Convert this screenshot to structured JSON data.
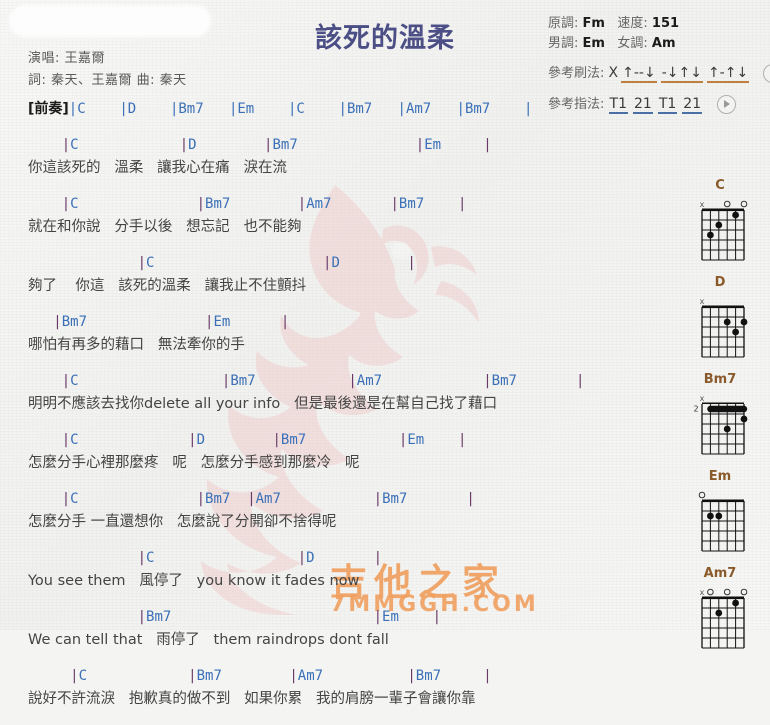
{
  "title": "該死的溫柔",
  "credits": {
    "singer": "演唱: 王嘉爾",
    "writer": "詞: 秦天、王嘉爾  曲: 秦天"
  },
  "meta": {
    "original_key_label": "原調:",
    "original_key": "Fm",
    "tempo_label": "速度:",
    "tempo": "151",
    "male_key_label": "男調:",
    "male_key": "Em",
    "female_key_label": "女調:",
    "female_key": "Am",
    "strum_label": "參考刷法:",
    "strum_x": "X",
    "strum_groups": [
      "↑--↓",
      "-↓↑↓",
      "↑-↑↓"
    ],
    "finger_label": "參考指法:",
    "finger_groups": [
      "T1",
      "21",
      "T1",
      "21"
    ]
  },
  "intro": {
    "label": "[前奏]",
    "chords": "|C    |D    |Bm7   |Em    |C    |Bm7   |Am7   |Bm7    |"
  },
  "stanzas": [
    {
      "chords": "    |C            |D        |Bm7              |Em     |",
      "lyrics": "你這該死的   溫柔   讓我心在痛   淚在流"
    },
    {
      "chords": "    |C              |Bm7        |Am7       |Bm7    |",
      "lyrics": "就在和你說   分手以後   想忘記   也不能夠"
    },
    {
      "chords": "             |C                    |D        |",
      "lyrics": "夠了    你這   該死的溫柔   讓我止不住顫抖"
    },
    {
      "chords": "   |Bm7              |Em      |",
      "lyrics": "哪怕有再多的藉口   無法牽你的手"
    },
    {
      "chords": "    |C                 |Bm7           |Am7            |Bm7       |",
      "lyrics": "明明不應該去找你delete all your info   但是最後還是在幫自己找了藉口"
    },
    {
      "chords": "    |C             |D        |Bm7           |Em    |",
      "lyrics": "怎麼分手心裡那麼疼   呢   怎麼分手感到那麼冷   呢"
    },
    {
      "chords": "    |C              |Bm7  |Am7           |Bm7       |",
      "lyrics": "怎麼分手 一直還想你   怎麼說了分開卻不捨得呢"
    },
    {
      "chords": "             |C                 |D       |",
      "lyrics": "You see them   風停了   you know it fades now"
    },
    {
      "chords": "             |Bm7                        |Em    |",
      "lyrics": "We can tell that   雨停了   them raindrops dont fall"
    },
    {
      "chords": "     |C            |Bm7        |Am7          |Bm7     |",
      "lyrics": "說好不許流淚   抱歉真的做不到   如果你累   我的肩膀一輩子會讓你靠"
    }
  ],
  "chord_diagrams": [
    {
      "name": "C",
      "base_fret": "",
      "markers": [
        "x",
        "",
        "",
        "o",
        "",
        "o"
      ],
      "dots": [
        {
          "string": 5,
          "fret": 3
        },
        {
          "string": 4,
          "fret": 2
        },
        {
          "string": 2,
          "fret": 1
        }
      ],
      "barre": null
    },
    {
      "name": "D",
      "base_fret": "",
      "markers": [
        "x",
        "",
        "",
        "",
        "",
        ""
      ],
      "dots": [
        {
          "string": 3,
          "fret": 2
        },
        {
          "string": 1,
          "fret": 2
        },
        {
          "string": 2,
          "fret": 3
        }
      ],
      "barre": null
    },
    {
      "name": "Bm7",
      "base_fret": "2",
      "markers": [
        "x",
        "",
        "",
        "",
        "",
        ""
      ],
      "dots": [
        {
          "string": 1,
          "fret": 2
        },
        {
          "string": 3,
          "fret": 3
        }
      ],
      "barre": {
        "fret": 1,
        "from_string": 5,
        "to_string": 1
      }
    },
    {
      "name": "Em",
      "base_fret": "",
      "markers": [
        "o",
        "",
        "",
        "",
        "",
        ""
      ],
      "dots": [
        {
          "string": 5,
          "fret": 2
        },
        {
          "string": 4,
          "fret": 2
        }
      ],
      "barre": null
    },
    {
      "name": "Am7",
      "base_fret": "",
      "markers": [
        "x",
        "o",
        "",
        "o",
        "",
        "o"
      ],
      "dots": [
        {
          "string": 4,
          "fret": 2
        },
        {
          "string": 2,
          "fret": 1
        }
      ],
      "barre": null
    }
  ],
  "watermark": {
    "brand": "吉他之家",
    "url": "7MMGGH.COM"
  },
  "colors": {
    "title": "#4c4f86",
    "chord": "#3b70b8",
    "bar": "#6a3b6a",
    "chord_name": "#8a5a2a",
    "watermark": "#f0a060",
    "dragon": "#f2b9bb"
  }
}
